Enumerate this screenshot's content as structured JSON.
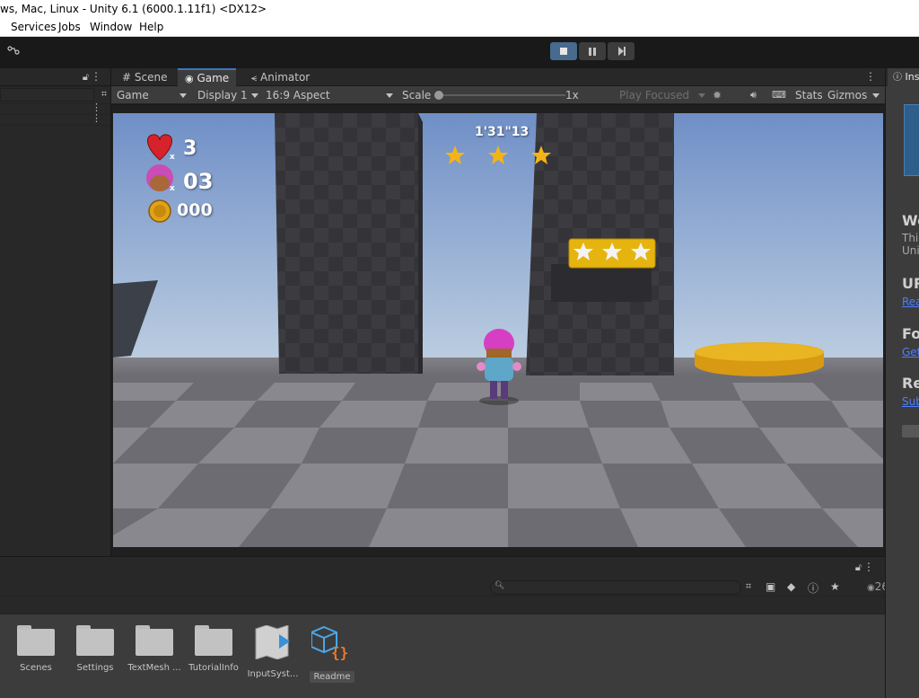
{
  "window": {
    "title": "ws, Mac, Linux - Unity 6.1 (6000.1.11f1) <DX12>"
  },
  "menu": {
    "items": [
      "Services",
      "Jobs",
      "Window",
      "Help"
    ]
  },
  "toolbar": {
    "vcs_icon": "branch-icon"
  },
  "game_tabs": {
    "scene": "# Scene",
    "game": "Game",
    "animator": "Animator"
  },
  "game_controls": {
    "game_label": "Game",
    "display": "Display 1",
    "aspect": "16:9 Aspect",
    "scale_label": "Scale",
    "scale_value": "1x",
    "play_focused": "Play Focused",
    "stats": "Stats",
    "gizmos": "Gizmos"
  },
  "hud": {
    "lives": "3",
    "players": "03",
    "coins": "000",
    "timer": "1'31\"13"
  },
  "project": {
    "count": "26",
    "assets": [
      {
        "label": "Scenes",
        "type": "folder"
      },
      {
        "label": "Settings",
        "type": "folder"
      },
      {
        "label": "TextMesh ...",
        "type": "folder"
      },
      {
        "label": "TutorialInfo",
        "type": "folder"
      },
      {
        "label": "InputSyst...",
        "type": "inputsystem"
      },
      {
        "label": "Readme",
        "type": "readme"
      }
    ]
  },
  "inspector": {
    "tab_label": "Ins",
    "sections": [
      {
        "heading": "We",
        "text": [
          "Thi",
          "Uni"
        ]
      },
      {
        "heading": "UR",
        "link": "Rea"
      },
      {
        "heading": "Fo",
        "link": "Get"
      },
      {
        "heading": "Re",
        "link": "Sub"
      }
    ]
  },
  "colors": {
    "accent": "#3a79bb",
    "link": "#4c7eff",
    "sky_top": "#6d8fc8",
    "floor_dark": "#5a5a60",
    "floor_light": "#8a8a90"
  }
}
